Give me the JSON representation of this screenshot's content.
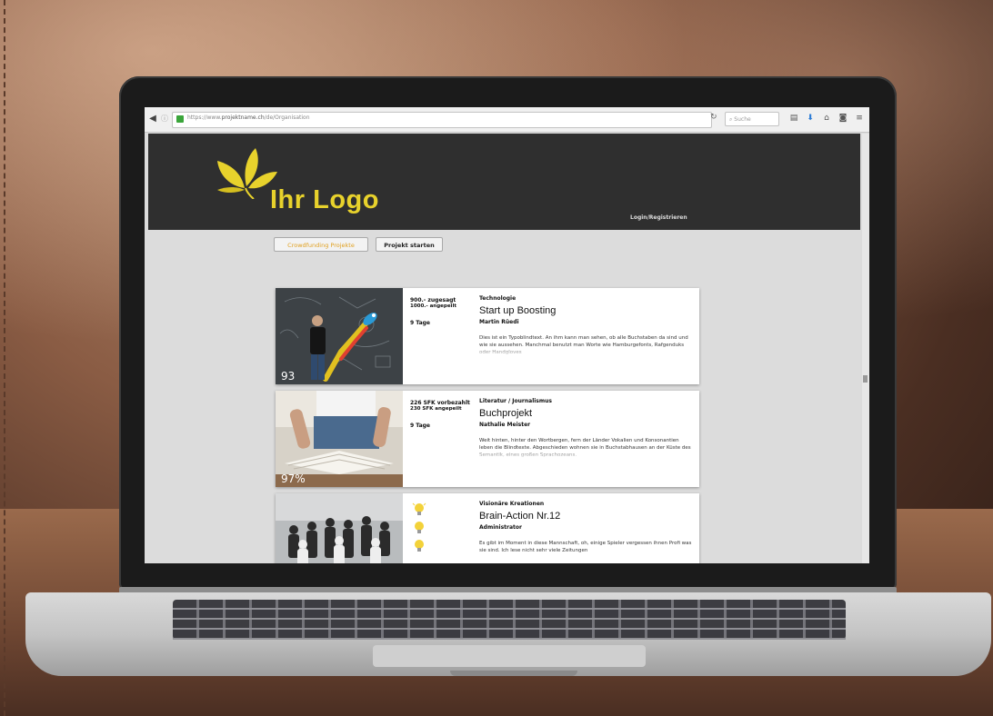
{
  "browser": {
    "url_prefix": "https://www.",
    "url_domain": "projektname.ch",
    "url_path": "/de/Organisation",
    "search_placeholder": "Suche"
  },
  "site": {
    "logo_text": "Ihr Logo",
    "login_link": "Login/Registrieren",
    "nav": {
      "crowdfunding": "Crowdfunding Projekte",
      "start": "Projekt starten"
    }
  },
  "projects": [
    {
      "pledged": "900.- zugesagt",
      "goal": "1000.- angepeilt",
      "days": "9 Tage",
      "category": "Technologie",
      "title": "Start up Boosting",
      "author": "Martin Rüedi",
      "description": "Dies ist ein Typoblindtext. An ihm kann man sehen, ob alle Buchstaben da sind und wie sie aussehen. Manchmal benutzt man Worte wie Hamburgefonts, Rafgenduks oder Handgloves",
      "percent": "93"
    },
    {
      "pledged": "226 SFK vorbezahlt",
      "goal": "230 SFK angepeilt",
      "days": "9 Tage",
      "category": "Literatur / Journalismus",
      "title": "Buchprojekt",
      "author": "Nathalie Meister",
      "description": "Weit hinten, hinter den Wortbergen, fern der Länder Vokalien und Konsonantien leben die Blindtexte. Abgeschieden wohnen sie in Buchstabhausen an der Küste des Semantik, eines großen Sprachozeans.",
      "percent": "97%"
    },
    {
      "category": "Visionäre Kreationen",
      "title": "Brain-Action Nr.12",
      "author": "Administrator",
      "description": "Es gibt im Moment in diese Mannschaft, oh, einige Spieler vergessen ihnen Profi was sie sind. Ich lese nicht sehr viele Zeitungen"
    }
  ],
  "colors": {
    "header_bg": "#2f2f2f",
    "logo_yellow": "#e8d22c",
    "crowd_orange": "#e0a020"
  }
}
